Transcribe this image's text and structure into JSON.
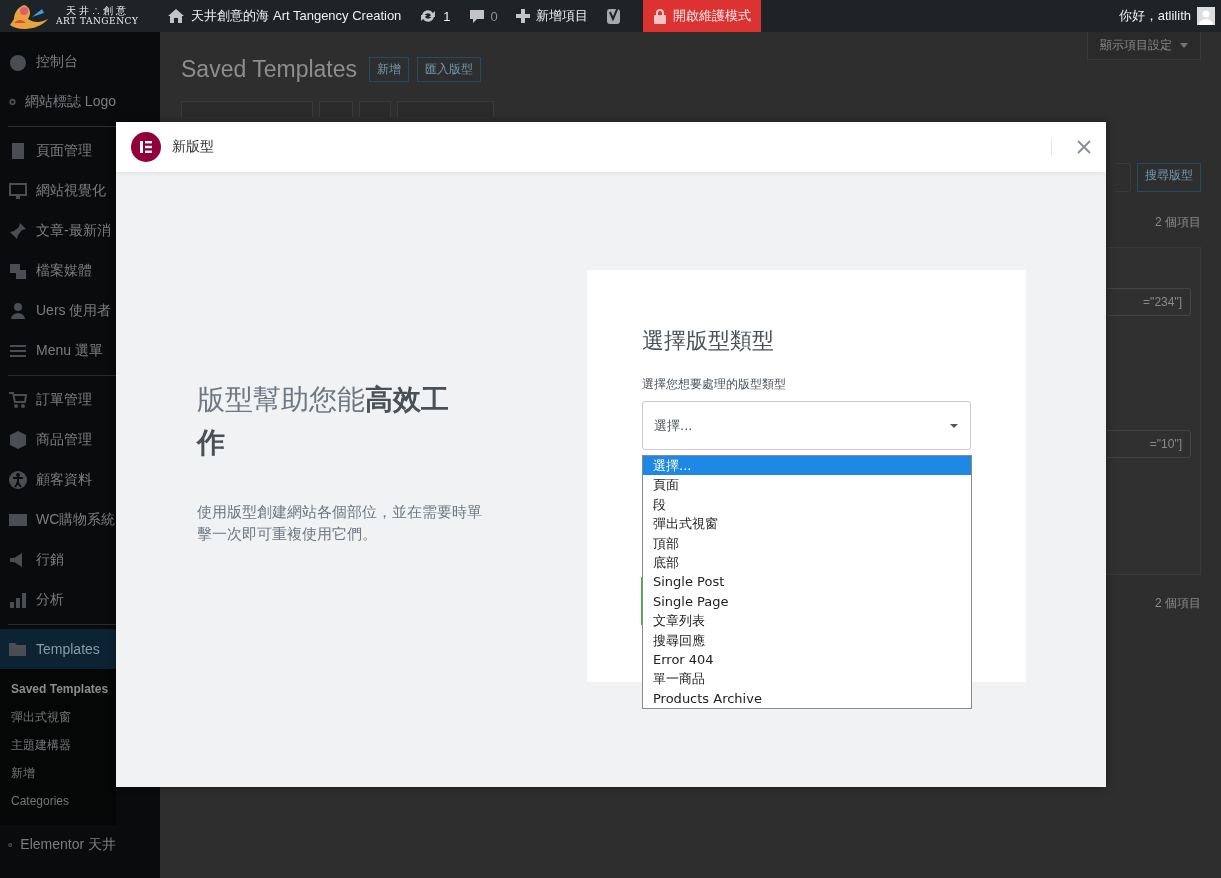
{
  "admin_bar": {
    "logo_text": "天井∴創意",
    "logo_subtext": "ART TANGENCY",
    "site_name": "天井創意的海 Art Tangency Creation",
    "updates": "1",
    "comments": "0",
    "new_item": "新增項目",
    "maintenance": "開啟維護模式",
    "greeting": "你好，atlilith"
  },
  "sidebar": {
    "items": [
      {
        "label": "控制台",
        "selected": false,
        "divider_after": false
      },
      {
        "label": "網站標誌 Logo",
        "selected": false,
        "divider_after": true
      },
      {
        "label": "頁面管理",
        "selected": false,
        "divider_after": false
      },
      {
        "label": "網站視覺化",
        "selected": false,
        "divider_after": false
      },
      {
        "label": "文章-最新消",
        "selected": false,
        "divider_after": false
      },
      {
        "label": "檔案媒體",
        "selected": false,
        "divider_after": false
      },
      {
        "label": "Uers 使用者",
        "selected": false,
        "divider_after": false
      },
      {
        "label": "Menu 選單",
        "selected": false,
        "divider_after": true
      },
      {
        "label": "訂單管理",
        "selected": false,
        "divider_after": false
      },
      {
        "label": "商品管理",
        "selected": false,
        "divider_after": false
      },
      {
        "label": "顧客資料",
        "selected": false,
        "divider_after": false
      },
      {
        "label": "WC購物系統",
        "selected": false,
        "divider_after": false
      },
      {
        "label": "行銷",
        "selected": false,
        "divider_after": false
      },
      {
        "label": "分析",
        "selected": false,
        "divider_after": true
      },
      {
        "label": "Templates",
        "selected": true,
        "divider_after": false,
        "children": [
          {
            "label": "Saved Templates",
            "selected": true
          },
          {
            "label": "彈出式視窗",
            "selected": false
          },
          {
            "label": "主題建構器",
            "selected": false
          },
          {
            "label": "新增",
            "selected": false
          },
          {
            "label": "Categories",
            "selected": false
          }
        ]
      },
      {
        "label": "Elementor 天井",
        "selected": false,
        "divider_after": false
      }
    ]
  },
  "page": {
    "title": "Saved Templates",
    "title_buttons": [
      "新增",
      "匯入版型"
    ],
    "screen_options": "顯示項目設定",
    "search_button": "搜尋版型",
    "item_count_top": "2 個項目",
    "field_values": [
      "=\"234\"]",
      "=\"10\"]"
    ],
    "item_count_bottom": "2 個項目"
  },
  "modal": {
    "title": "新版型",
    "intro_heading": "版型幫助您能**高效工作**",
    "intro_text": "使用版型創建網站各個部位，並在需要時單擊一次即可重複使用它們。",
    "form_title": "選擇版型類型",
    "select_label": "選擇您想要處理的版型類型",
    "select_value": "選擇...",
    "options": [
      {
        "label": "選擇...",
        "selected": true
      },
      {
        "label": "頁面",
        "selected": false
      },
      {
        "label": "段",
        "selected": false
      },
      {
        "label": "彈出式視窗",
        "selected": false
      },
      {
        "label": "頂部",
        "selected": false
      },
      {
        "label": "底部",
        "selected": false
      },
      {
        "label": "Single Post",
        "selected": false
      },
      {
        "label": "Single Page",
        "selected": false
      },
      {
        "label": "文章列表",
        "selected": false
      },
      {
        "label": "搜尋回應",
        "selected": false
      },
      {
        "label": "Error 404",
        "selected": false
      },
      {
        "label": "單一商品",
        "selected": false
      },
      {
        "label": "Products Archive",
        "selected": false
      }
    ]
  }
}
